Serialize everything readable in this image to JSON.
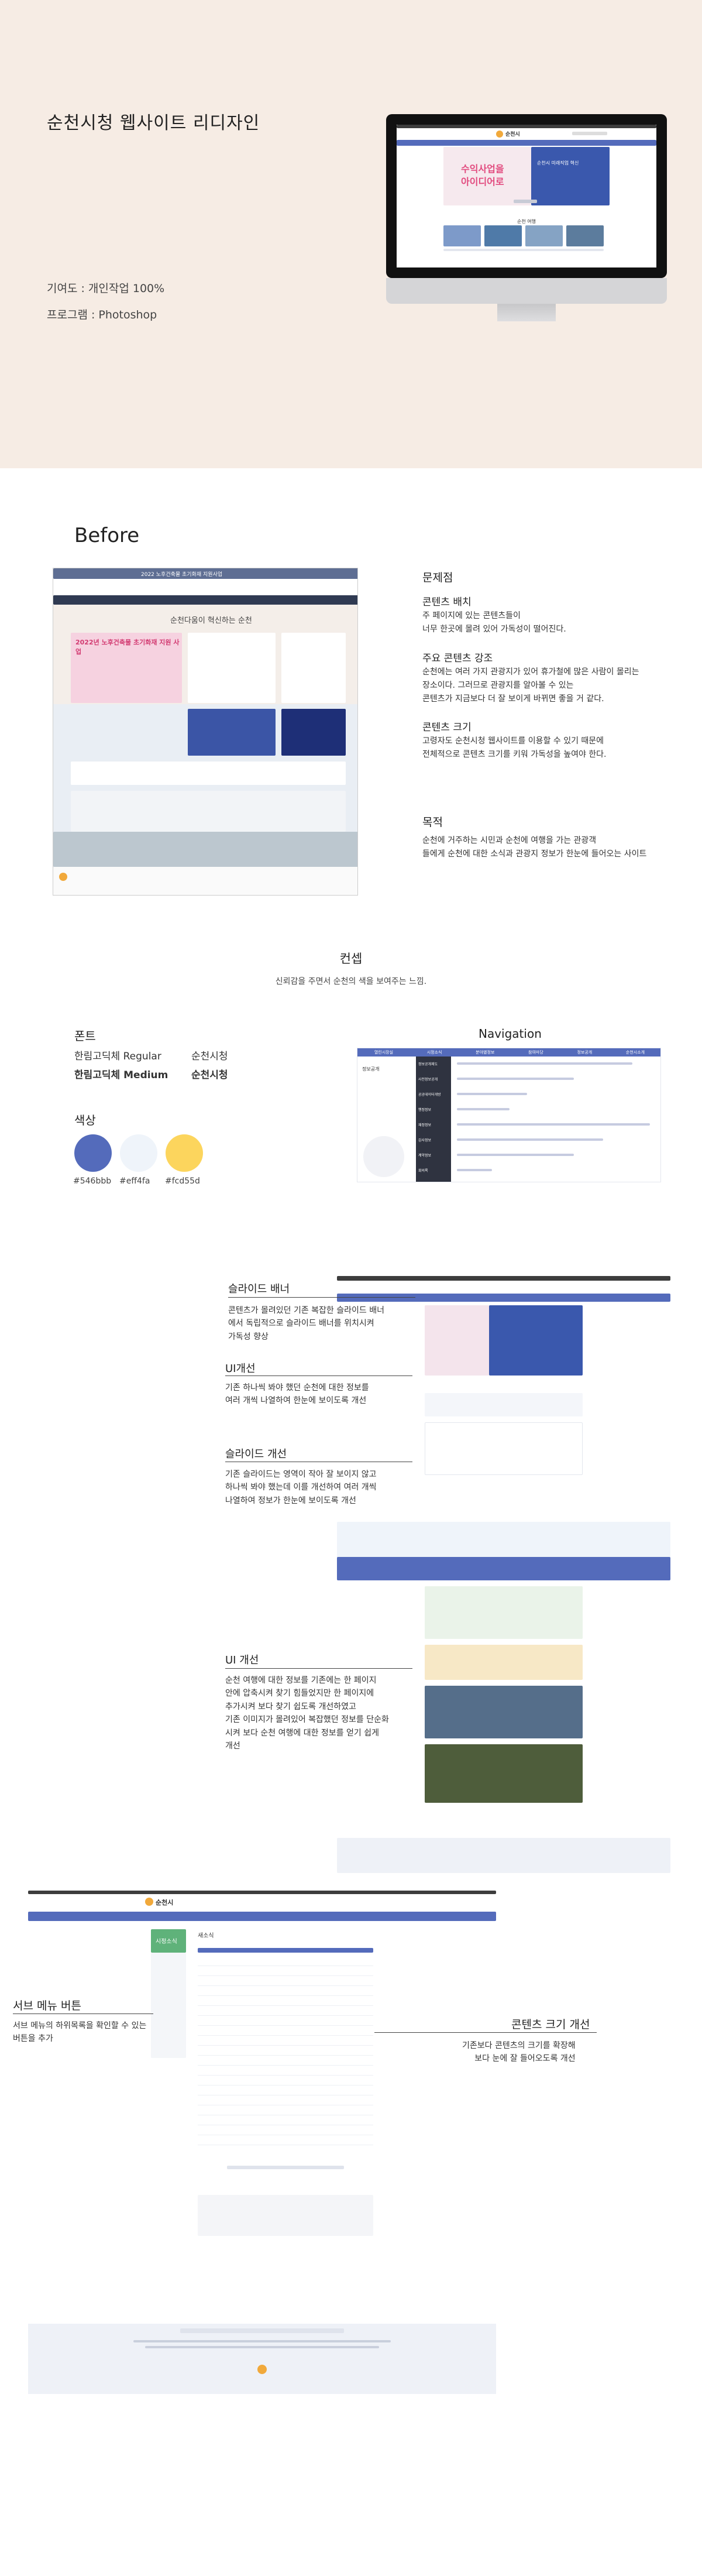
{
  "hero": {
    "title": "순천시청 웹사이트 리디자인",
    "contribution": "기여도 : 개인작업 100%",
    "program": "프로그램 : Photoshop"
  },
  "mockup_site": {
    "city_name": "순천시",
    "banner_headline_1": "수익사업을",
    "banner_headline_2": "아이디어로",
    "banner_side": "순천시 미래직업 혁신",
    "section_label": "순천 여행"
  },
  "before": {
    "title": "Before",
    "site": {
      "top_notice": "2022 노후건축물 초기화재 지원사업",
      "slogan": "순천다움이 혁신하는 순천",
      "notice_title": "2022년 노후건축물 초기화재 지원 사업"
    },
    "problems": {
      "heading": "문제점",
      "items": [
        {
          "title": "콘텐츠 배치",
          "text": "주 페이지에 있는 콘텐츠들이\n너무 한곳에 몰려 있어 가독성이 떨어진다."
        },
        {
          "title": "주요 콘텐츠 강조",
          "text": "순천에는 여러 가지 관광지가 있어 휴가철에 많은 사람이 몰리는\n장소이다. 그러므로 관광지를 알아볼 수 있는\n콘텐츠가 지금보다 더 잘 보이게 바뀌면 좋을 거 같다."
        },
        {
          "title": "콘텐츠 크기",
          "text": "고령자도 순천시청 웹사이트를 이용할 수 있기 때문에\n전체적으로 콘텐츠 크기를 키워 가독성을 높여야 한다."
        }
      ]
    },
    "purpose": {
      "heading": "목적",
      "text": "순천에 거주하는 시민과 순천에 여행을 가는 관광객\n들에게 순천에 대한 소식과 관광지 정보가 한눈에 들어오는 사이트"
    },
    "concept": {
      "heading": "컨셉",
      "text": "신뢰감을 주면서 순천의 색을 보여주는 느낌."
    }
  },
  "style_guide": {
    "font_heading": "폰트",
    "fonts": [
      {
        "name": "한림고딕체 Regular",
        "sample": "순천시청"
      },
      {
        "name": "한림고딕체 Medium",
        "sample": "순천시청"
      }
    ],
    "color_heading": "색상",
    "colors": [
      {
        "hex": "#546bbb",
        "label": "#546bbb"
      },
      {
        "hex": "#eff4fa",
        "label": "#eff4fa"
      },
      {
        "hex": "#fcd55d",
        "label": "#fcd55d"
      }
    ],
    "nav_heading": "Navigation"
  },
  "nav_menu": {
    "top_items": [
      "열린시장실",
      "시정소식",
      "분야별정보",
      "참여마당",
      "정보공개",
      "순천시소개"
    ],
    "side_label": "정보공개",
    "rows": [
      "정보공개제도",
      "사전정보공개",
      "공공데이터개방",
      "행정정보",
      "재정정보",
      "감사정보",
      "계약정보",
      "회의록"
    ]
  },
  "annotations": [
    {
      "title": "슬라이드 배너",
      "text": "콘텐츠가 몰려있던 기존 복잡한 슬라이드 배너\n에서 독립적으로 슬라이드 배너를 위치시켜\n가독성 향상"
    },
    {
      "title": "UI개선",
      "text": "기존 하나씩 봐야 했던 순천에 대한 정보를\n여러 개씩 나열하여 한눈에 보이도록 개선"
    },
    {
      "title": "슬라이드 개선",
      "text": "기존 슬라이드는 영역이 작아 잘 보이지 않고\n하나씩 봐야 했는데 이를 개선하여 여러 개씩\n나열하여 정보가 한눈에 보이도록 개선"
    },
    {
      "title": "UI 개선",
      "text": "순천 여행에 대한 정보를 기존에는 한 페이지\n안에 압축시켜 찾기 힘들었지만 한 페이지에\n추가시켜 보다 찾기 쉽도록 개선하였고\n기존 이미지가 몰려있어 복잡했던 정보를 단순화\n시켜 보다 순천 여행에 대한 정보를 얻기 쉽게\n개선"
    }
  ],
  "sub_page": {
    "sub_menu_title": "서브 메뉴 버튼",
    "sub_menu_text": "서브 메뉴의 하위목록을 확인할 수 있는\n버튼을 추가",
    "content_size_title": "콘텐츠 크기 개선",
    "content_size_text": "기존보다 콘텐츠의 크기를 확장해\n보다 눈에 잘 들어오도록 개선",
    "side_title": "시정소식",
    "board_title": "새소식",
    "city_name": "순천시"
  }
}
